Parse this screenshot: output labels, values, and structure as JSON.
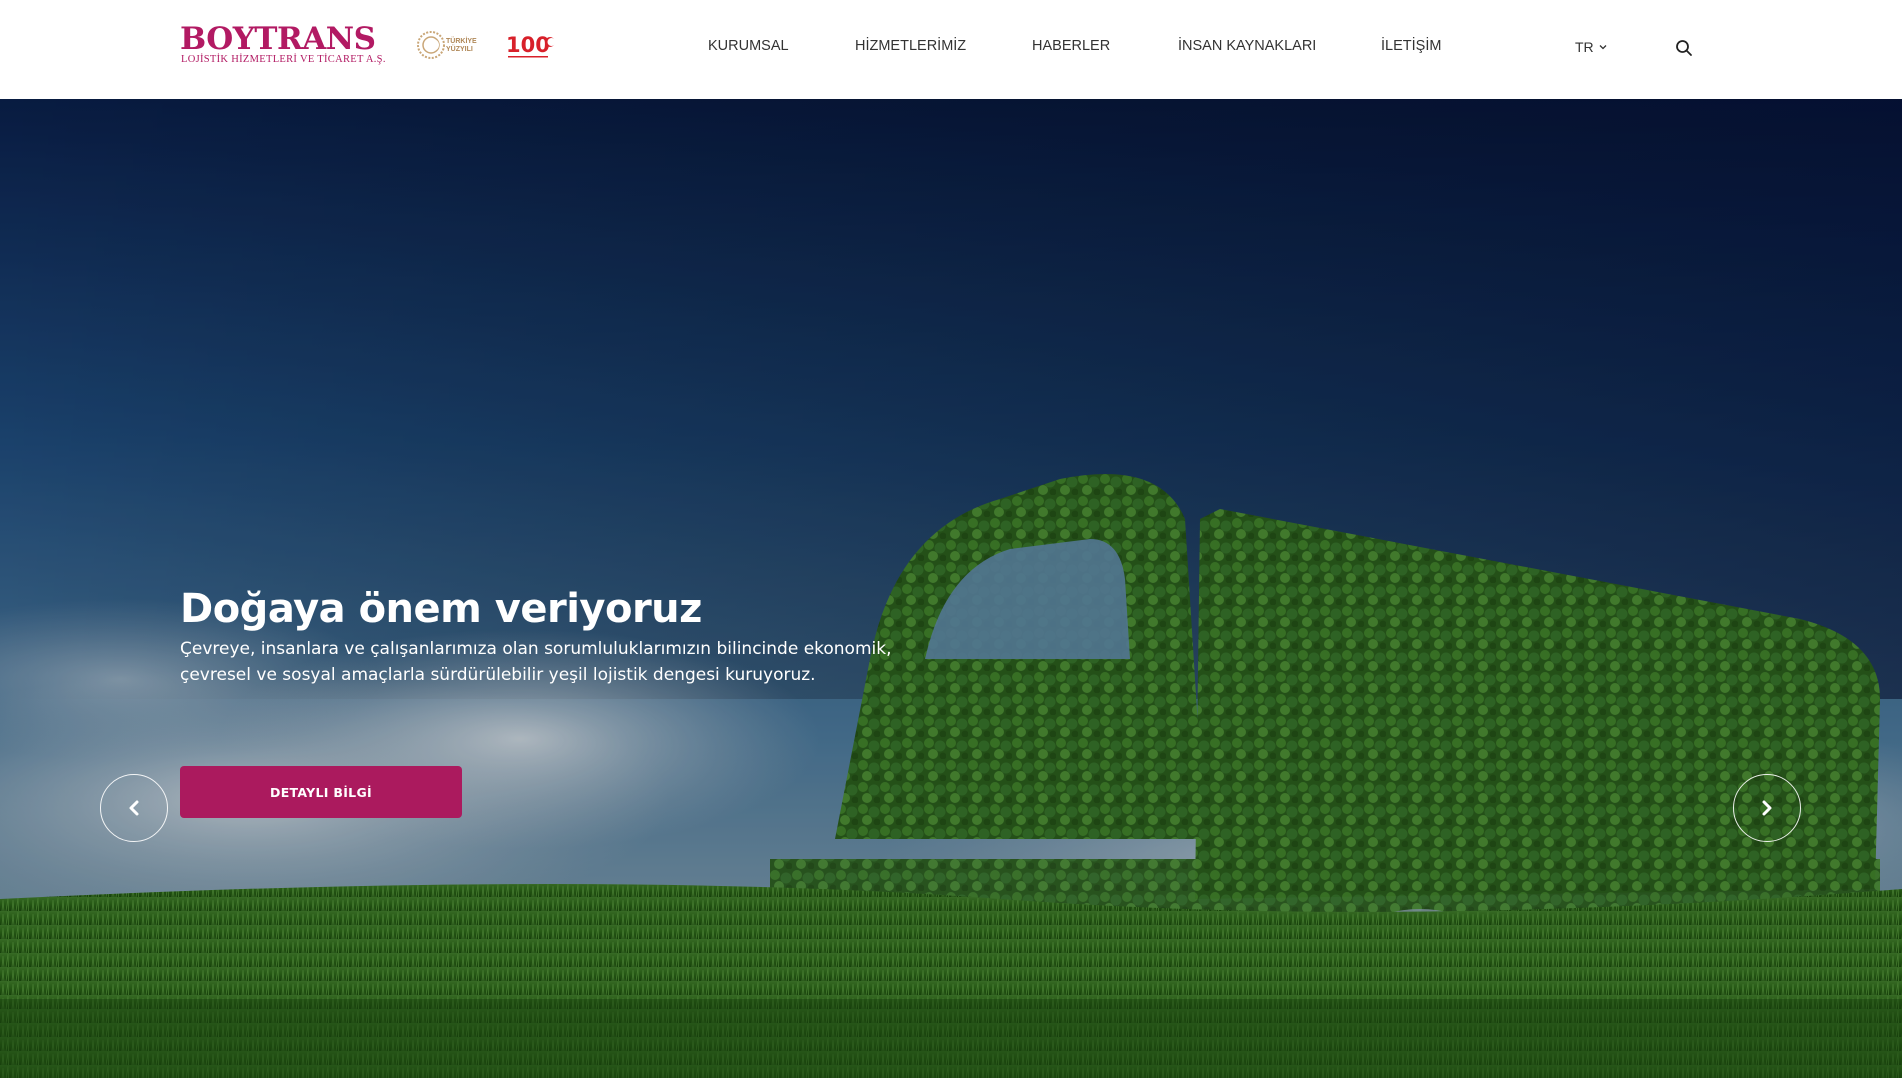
{
  "brand": {
    "name": "BOYTRANS",
    "subtitle": "LOJİSTİK HİZMETLERİ VE TİCARET A.Ş.",
    "color": "#b21a63",
    "badge_turkiye_line1": "TÜRKİYE",
    "badge_turkiye_line2": "YÜZYILI",
    "badge_100": "100"
  },
  "nav": {
    "items": [
      {
        "label": "KURUMSAL"
      },
      {
        "label": "HİZMETLERİMİZ"
      },
      {
        "label": "HABERLER"
      },
      {
        "label": "İNSAN KAYNAKLARI"
      },
      {
        "label": "İLETİŞİM"
      }
    ],
    "language": "TR"
  },
  "icons": {
    "search": "search-icon",
    "language_dropdown": "chevron-down-icon",
    "prev": "chevron-left-icon",
    "next": "chevron-right-icon"
  },
  "hero": {
    "title": "Doğaya önem veriyoruz",
    "description": "Çevreye, insanlara ve çalışanlarımıza olan sorumluluklarımızın bilincinde ekonomik, çevresel ve sosyal amaçlarla sürdürülebilir yeşil lojistik dengesi kuruyoruz.",
    "button_label": "DETAYLI BİLGİ",
    "button_color": "#ab1a5e"
  }
}
